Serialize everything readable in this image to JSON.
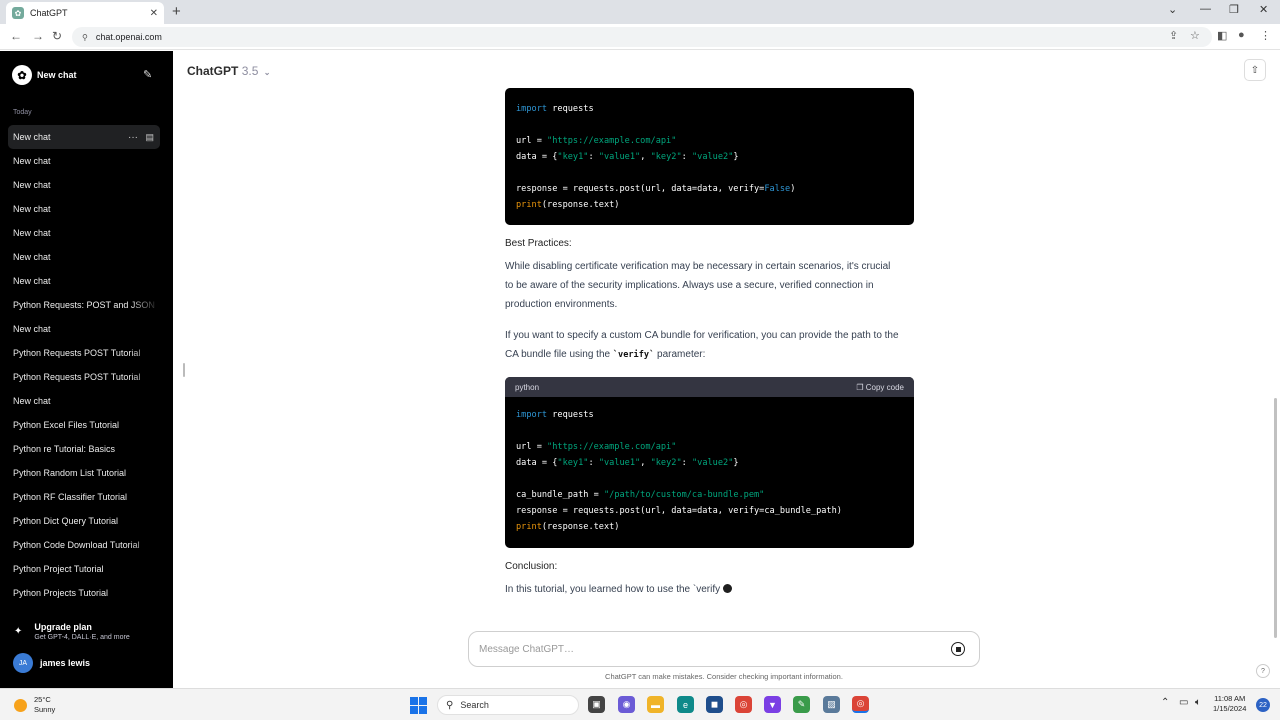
{
  "browser": {
    "tab_title": "ChatGPT",
    "url": "chat.openai.com"
  },
  "sidebar": {
    "new_chat": "New chat",
    "section": "Today",
    "items": [
      "New chat",
      "New chat",
      "New chat",
      "New chat",
      "New chat",
      "New chat",
      "New chat",
      "Python Requests: POST and JSON",
      "New chat",
      "Python Requests POST Tutorial",
      "Python Requests POST Tutorial",
      "New chat",
      "Python Excel Files Tutorial",
      "Python re Tutorial: Basics",
      "Python Random List Tutorial",
      "Python RF Classifier Tutorial",
      "Python Dict Query Tutorial",
      "Python Code Download Tutorial",
      "Python Project Tutorial",
      "Python Projects Tutorial"
    ],
    "upgrade_title": "Upgrade plan",
    "upgrade_sub": "Get GPT-4, DALL·E, and more",
    "user_initials": "JA",
    "user_name": "james lewis"
  },
  "header": {
    "model": "ChatGPT",
    "version": "3.5"
  },
  "content": {
    "code1": {
      "lines": [
        [
          {
            "t": "import",
            "c": "kw"
          },
          {
            "t": " requests"
          }
        ],
        [],
        [
          {
            "t": "url = "
          },
          {
            "t": "\"https://example.com/api\"",
            "c": "str"
          }
        ],
        [
          {
            "t": "data = {"
          },
          {
            "t": "\"key1\"",
            "c": "str"
          },
          {
            "t": ": "
          },
          {
            "t": "\"value1\"",
            "c": "str"
          },
          {
            "t": ", "
          },
          {
            "t": "\"key2\"",
            "c": "str"
          },
          {
            "t": ": "
          },
          {
            "t": "\"value2\"",
            "c": "str"
          },
          {
            "t": "}"
          }
        ],
        [],
        [
          {
            "t": "response = requests.post(url, data=data, verify="
          },
          {
            "t": "False",
            "c": "bool"
          },
          {
            "t": ")"
          }
        ],
        [
          {
            "t": "print",
            "c": "fn"
          },
          {
            "t": "(response.text)"
          }
        ]
      ]
    },
    "best_practices_heading": "Best Practices:",
    "best_practices_text": "While disabling certificate verification may be necessary in certain scenarios, it's crucial to be aware of the security implications. Always use a secure, verified connection in production environments.",
    "ca_text_before": "If you want to specify a custom CA bundle for verification, you can provide the path to the CA bundle file using the ",
    "ca_text_code": "`verify`",
    "ca_text_after": " parameter:",
    "code2": {
      "language": "python",
      "copy_label": "Copy code",
      "lines": [
        [
          {
            "t": "import",
            "c": "kw"
          },
          {
            "t": " requests"
          }
        ],
        [],
        [
          {
            "t": "url = "
          },
          {
            "t": "\"https://example.com/api\"",
            "c": "str"
          }
        ],
        [
          {
            "t": "data = {"
          },
          {
            "t": "\"key1\"",
            "c": "str"
          },
          {
            "t": ": "
          },
          {
            "t": "\"value1\"",
            "c": "str"
          },
          {
            "t": ", "
          },
          {
            "t": "\"key2\"",
            "c": "str"
          },
          {
            "t": ": "
          },
          {
            "t": "\"value2\"",
            "c": "str"
          },
          {
            "t": "}"
          }
        ],
        [],
        [
          {
            "t": "ca_bundle_path = "
          },
          {
            "t": "\"/path/to/custom/ca-bundle.pem\"",
            "c": "str"
          }
        ],
        [
          {
            "t": "response = requests.post(url, data=data, verify=ca_bundle_path)"
          }
        ],
        [
          {
            "t": "print",
            "c": "fn"
          },
          {
            "t": "(response.text)"
          }
        ]
      ]
    },
    "conclusion_heading": "Conclusion:",
    "conclusion_text": "In this tutorial, you learned how to use the `verify"
  },
  "composer": {
    "placeholder": "Message ChatGPT…",
    "disclaimer": "ChatGPT can make mistakes. Consider checking important information.",
    "help": "?"
  },
  "taskbar": {
    "temperature": "25°C",
    "weather": "Sunny",
    "search": "Search",
    "time": "11:08 AM",
    "date": "1/15/2024",
    "notifications": "22"
  }
}
